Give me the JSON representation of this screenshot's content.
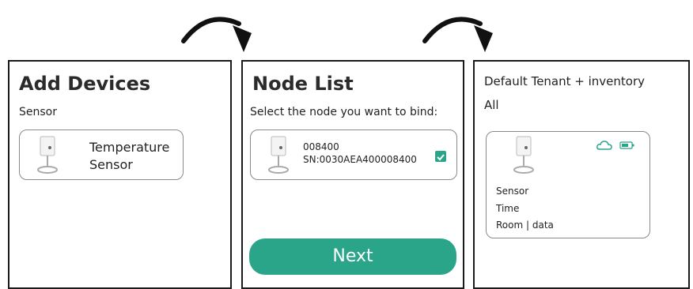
{
  "panel1": {
    "title": "Add Devices",
    "category": "Sensor",
    "device": {
      "line1": "Temperature",
      "line2": "Sensor",
      "icon": "sensor-device-icon"
    }
  },
  "panel2": {
    "title": "Node List",
    "prompt": "Select the node you want to bind:",
    "node": {
      "id": "008400",
      "serial": "SN:0030AEA400008400",
      "checked": true,
      "icon": "sensor-device-icon"
    },
    "next_label": "Next"
  },
  "panel3": {
    "header": "Default Tenant + inventory",
    "filter": "All",
    "card": {
      "line1": "Sensor",
      "line2": "Time",
      "line3": "Room | data",
      "status_icons": [
        "cloud-icon",
        "battery-icon"
      ]
    }
  },
  "colors": {
    "accent": "#2aa58a",
    "border": "#1a1a1a"
  }
}
